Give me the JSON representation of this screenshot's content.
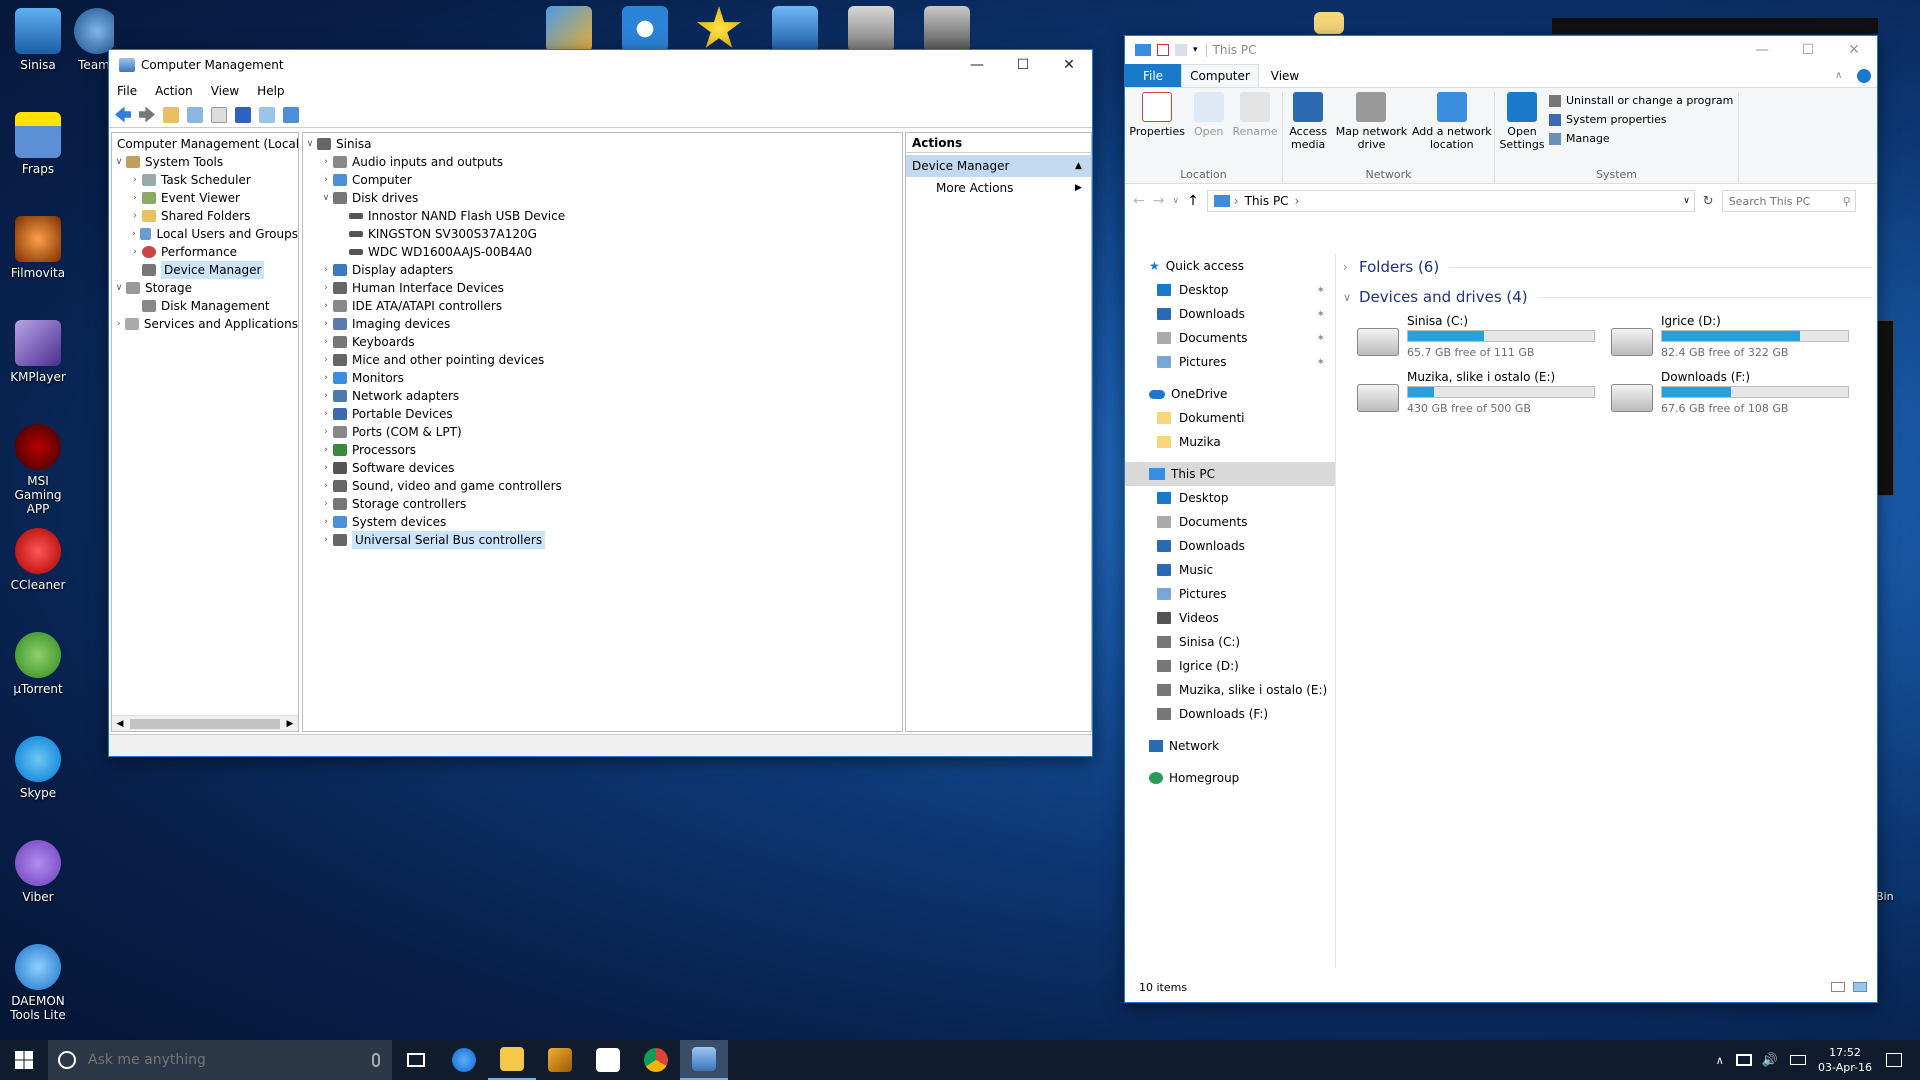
{
  "desktop": {
    "icons": [
      "Sinisa",
      "Team",
      "Fraps",
      "Filmovita",
      "KMPlayer",
      "MSI Gaming APP",
      "CCleaner",
      "µTorrent",
      "Skype",
      "Viber",
      "DAEMON Tools Lite"
    ],
    "right_fragment": "Bin"
  },
  "cm": {
    "title": "Computer Management",
    "menu": [
      "File",
      "Action",
      "View",
      "Help"
    ],
    "left_tree": {
      "root": "Computer Management (Local",
      "system_tools": "System Tools",
      "task_scheduler": "Task Scheduler",
      "event_viewer": "Event Viewer",
      "shared_folders": "Shared Folders",
      "local_users": "Local Users and Groups",
      "performance": "Performance",
      "device_manager": "Device Manager",
      "storage": "Storage",
      "disk_management": "Disk Management",
      "services": "Services and Applications"
    },
    "devices": {
      "root": "Sinisa",
      "items": [
        "Audio inputs and outputs",
        "Computer",
        "Disk drives",
        "Display adapters",
        "Human Interface Devices",
        "IDE ATA/ATAPI controllers",
        "Imaging devices",
        "Keyboards",
        "Mice and other pointing devices",
        "Monitors",
        "Network adapters",
        "Portable Devices",
        "Ports (COM & LPT)",
        "Processors",
        "Software devices",
        "Sound, video and game controllers",
        "Storage controllers",
        "System devices",
        "Universal Serial Bus controllers"
      ],
      "disks": [
        "Innostor NAND Flash USB Device",
        "KINGSTON SV300S37A120G",
        "WDC WD1600AAJS-00B4A0"
      ]
    },
    "actions": {
      "header": "Actions",
      "section": "Device Manager",
      "more": "More Actions"
    }
  },
  "explorer": {
    "title": "This PC",
    "tabs": [
      "File",
      "Computer",
      "View"
    ],
    "ribbon": {
      "properties": "Properties",
      "open": "Open",
      "rename": "Rename",
      "access_media": "Access media",
      "map_network": "Map network drive",
      "add_network": "Add a network location",
      "open_settings": "Open Settings",
      "uninstall": "Uninstall or change a program",
      "system_properties": "System properties",
      "manage": "Manage",
      "group_location": "Location",
      "group_network": "Network",
      "group_system": "System"
    },
    "address": "This PC",
    "search_placeholder": "Search This PC",
    "nav": {
      "quick_access": "Quick access",
      "qa_items": [
        "Desktop",
        "Downloads",
        "Documents",
        "Pictures"
      ],
      "onedrive": "OneDrive",
      "od_items": [
        "Dokumenti",
        "Muzika"
      ],
      "this_pc": "This PC",
      "pc_items": [
        "Desktop",
        "Documents",
        "Downloads",
        "Music",
        "Pictures",
        "Videos",
        "Sinisa (C:)",
        "Igrice (D:)",
        "Muzika, slike i ostalo (E:)",
        "Downloads (F:)"
      ],
      "network": "Network",
      "homegroup": "Homegroup"
    },
    "folders_header": "Folders (6)",
    "devices_header": "Devices and drives (4)",
    "drives": [
      {
        "name": "Sinisa (C:)",
        "free": "65.7 GB free of 111 GB",
        "used_fraction": 0.41
      },
      {
        "name": "Igrice (D:)",
        "free": "82.4 GB free of 322 GB",
        "used_fraction": 0.74
      },
      {
        "name": "Muzika, slike i ostalo (E:)",
        "free": "430 GB free of 500 GB",
        "used_fraction": 0.14
      },
      {
        "name": "Downloads (F:)",
        "free": "67.6 GB free of 108 GB",
        "used_fraction": 0.37
      }
    ],
    "status": "10 items"
  },
  "taskbar": {
    "search_placeholder": "Ask me anything",
    "time": "17:52",
    "date": "03-Apr-16"
  },
  "colors": {
    "accent": "#1979ca",
    "drive_fill": "#26a0da",
    "taskbar": "#101c2e"
  }
}
